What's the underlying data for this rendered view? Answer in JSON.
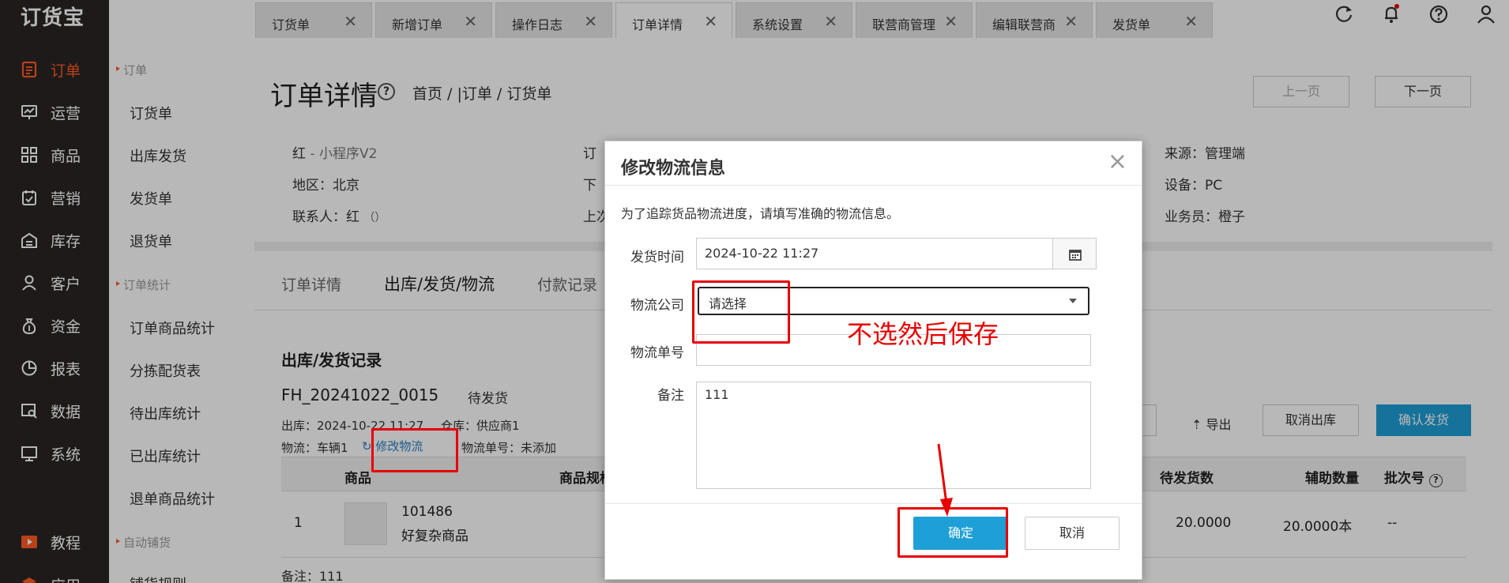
{
  "app": {
    "logo": "订货宝"
  },
  "nav": {
    "items": [
      {
        "label": "订单",
        "icon": "order-icon",
        "active": true
      },
      {
        "label": "运营",
        "icon": "operation-icon"
      },
      {
        "label": "商品",
        "icon": "product-icon"
      },
      {
        "label": "营销",
        "icon": "marketing-icon"
      },
      {
        "label": "库存",
        "icon": "warehouse-icon"
      },
      {
        "label": "客户",
        "icon": "customer-icon"
      },
      {
        "label": "资金",
        "icon": "money-bag-icon"
      },
      {
        "label": "报表",
        "icon": "report-icon"
      },
      {
        "label": "数据",
        "icon": "data-icon"
      },
      {
        "label": "系统",
        "icon": "monitor-icon"
      },
      {
        "label": "教程",
        "icon": "video-icon"
      },
      {
        "label": "应用",
        "icon": "app-icon"
      }
    ]
  },
  "subnav": {
    "group_order": "订单",
    "order_items": [
      "订货单",
      "出库发货",
      "发货单",
      "退货单"
    ],
    "group_stats": "订单统计",
    "stats_items": [
      "订单商品统计",
      "分拣配货表",
      "待出库统计",
      "已出库统计",
      "退单商品统计"
    ],
    "group_auto": "自动铺货",
    "auto_items": [
      "铺货规则"
    ]
  },
  "tabs": [
    {
      "label": "订货单"
    },
    {
      "label": "新增订单"
    },
    {
      "label": "操作日志"
    },
    {
      "label": "订单详情",
      "active": true
    },
    {
      "label": "系统设置"
    },
    {
      "label": "联营商管理"
    },
    {
      "label": "编辑联营商"
    },
    {
      "label": "发货单"
    }
  ],
  "page": {
    "title": "订单详情",
    "breadcrumb": "首页 / |订单 / 订货单",
    "prev": "上一页",
    "next": "下一页"
  },
  "info": {
    "name_prefix": "红",
    "name_suffix": " - 小程序V2",
    "region": "地区：北京",
    "contact": "联系人：红",
    "contact_paren": "（）",
    "col2_1": "订",
    "col2_2": "下",
    "col2_3": "上次",
    "source": "来源：管理端",
    "device": "设备：PC",
    "salesman": "业务员：橙子"
  },
  "detail_tabs": [
    "订单详情",
    "出库/发货/物流",
    "付款记录"
  ],
  "shipping": {
    "section_title": "出库/发货记录",
    "number": "FH_20241022_0015",
    "status": "待发货",
    "out_time": "出库：2024-10-22 11:27",
    "warehouse": "仓库：供应商1",
    "logistics": "物流：车辆1",
    "edit_link": "修改物流",
    "tracking": "物流单号：未添加",
    "export": "导出",
    "cancel_out": "取消出库",
    "confirm_ship": "确认发货"
  },
  "table": {
    "headers": {
      "product": "商品",
      "spec": "商品规格",
      "pending": "待发货数",
      "aux": "辅助数量",
      "batch": "批次号"
    },
    "row": {
      "index": "1",
      "code": "101486",
      "name": "好复杂商品",
      "pending": "20.0000",
      "aux": "20.0000本",
      "batch": "--"
    },
    "remark": "备注：111"
  },
  "modal": {
    "title": "修改物流信息",
    "hint": "为了追踪货品物流进度，请填写准确的物流信息。",
    "ship_time_label": "发货时间",
    "ship_time_value": "2024-10-22 11:27",
    "company_label": "物流公司",
    "company_value": "请选择",
    "tracking_label": "物流单号",
    "tracking_value": "",
    "remark_label": "备注",
    "remark_value": "111",
    "ok": "确定",
    "cancel": "取消"
  },
  "annotation": {
    "text": "不选然后保存",
    "color": "#e60000"
  },
  "colors": {
    "accent": "#ff5a24",
    "primary_button": "#1e9fd6",
    "sidebar": "#2b2524"
  }
}
